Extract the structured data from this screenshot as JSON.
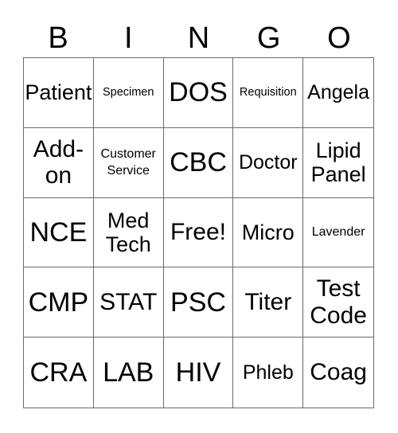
{
  "header": {
    "letters": [
      "B",
      "I",
      "N",
      "G",
      "O"
    ]
  },
  "board": {
    "rows": [
      [
        "Patient",
        "Specimen",
        "DOS",
        "Requisition",
        "Angela"
      ],
      [
        "Add-\non",
        "Customer\nService",
        "CBC",
        "Doctor",
        "Lipid\nPanel"
      ],
      [
        "NCE",
        "Med\nTech",
        "Free!",
        "Micro",
        "Lavender"
      ],
      [
        "CMP",
        "STAT",
        "PSC",
        "Titer",
        "Test\nCode"
      ],
      [
        "CRA",
        "LAB",
        "HIV",
        "Phleb",
        "Coag"
      ]
    ],
    "free_space": "Free!"
  }
}
